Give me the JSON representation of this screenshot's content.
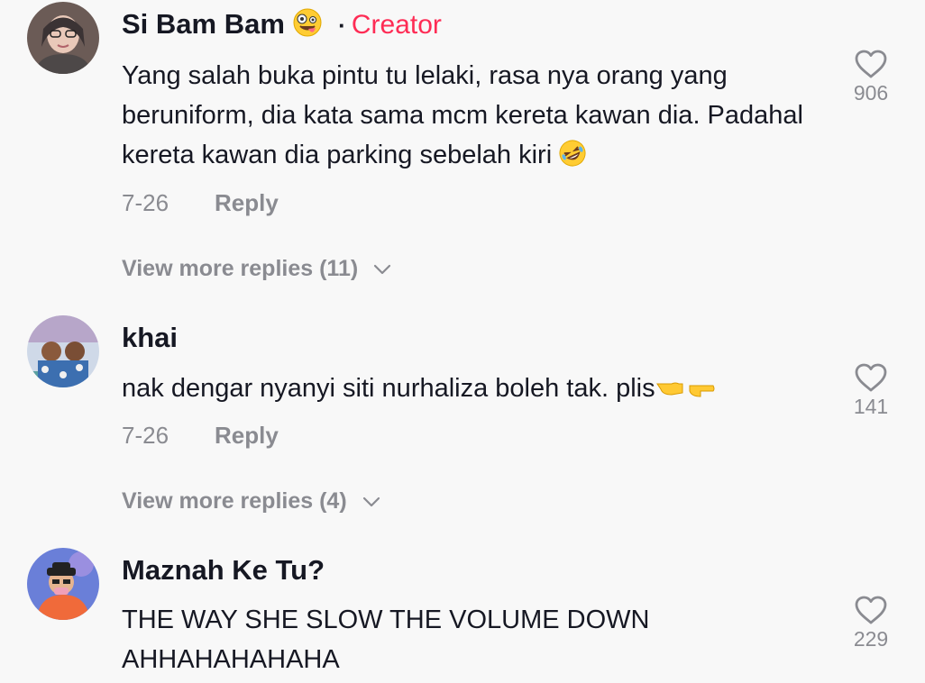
{
  "comments": [
    {
      "username": "Si Bam Bam",
      "badge_separator": "·",
      "badge": "Creator",
      "name_emoji": "zany-face-emoji",
      "text": "Yang salah buka pintu tu lelaki, rasa nya orang yang beruniform, dia kata sama mcm kereta kawan dia. Padahal kereta kawan dia parking sebelah kiri",
      "text_emoji": "rolling-laughing-emoji",
      "date": "7-26",
      "reply_label": "Reply",
      "view_more": "View more replies (11)",
      "likes": "906"
    },
    {
      "username": "khai",
      "text": "nak dengar nyanyi siti nurhaliza boleh tak. plis",
      "text_emoji": "pointing-hands-emoji",
      "date": "7-26",
      "reply_label": "Reply",
      "view_more": "View more replies (4)",
      "likes": "141"
    },
    {
      "username": "Maznah Ke Tu?",
      "text": "THE WAY SHE SLOW THE VOLUME DOWN AHHAHAHAHAHA",
      "likes": "229"
    }
  ],
  "colors": {
    "background": "#f8f8f8",
    "creator_badge": "#fe2c55",
    "secondary_text": "#8a8b91",
    "primary_text": "#161823"
  },
  "icons": {
    "like": "heart-outline-icon",
    "expand": "chevron-down-icon"
  }
}
